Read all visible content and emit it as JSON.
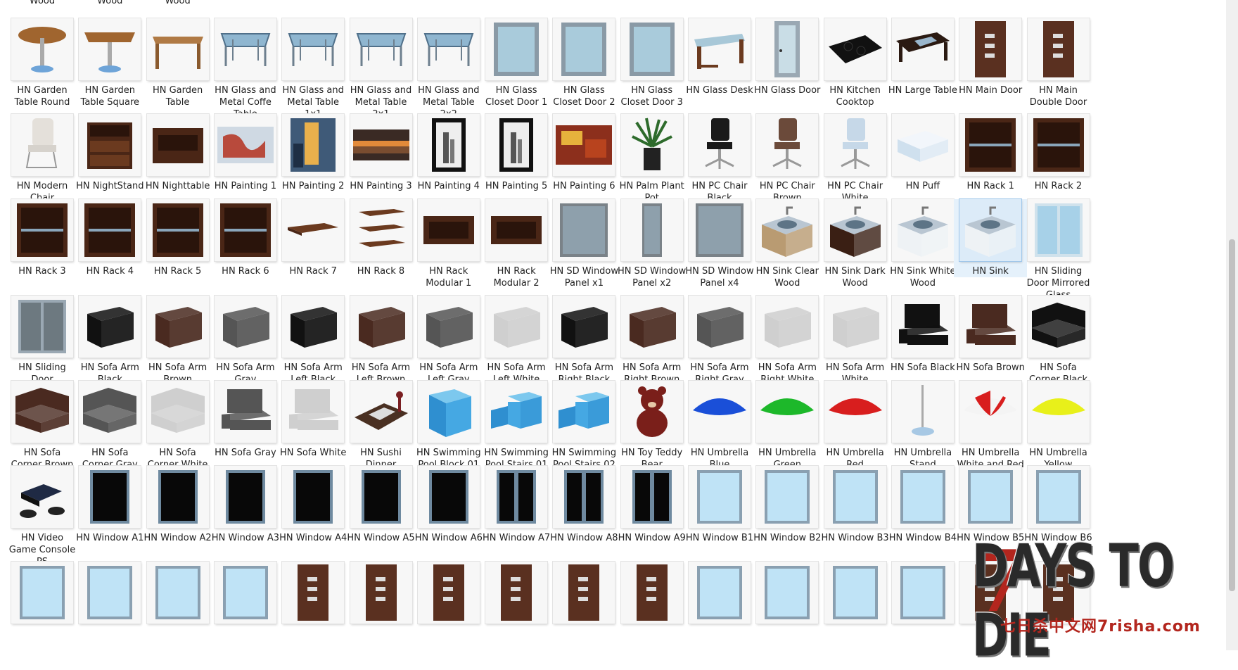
{
  "top_partial_labels": [
    "Wood",
    "Wood",
    "Wood"
  ],
  "items": [
    {
      "label": "HN Garden Table Round",
      "icon": "round-table"
    },
    {
      "label": "HN Garden Table Square",
      "icon": "square-table"
    },
    {
      "label": "HN Garden Table",
      "icon": "wood-table"
    },
    {
      "label": "HN Glass and Metal Coffe Table",
      "icon": "glass-table"
    },
    {
      "label": "HN Glass and Metal Table 1x1",
      "icon": "glass-table"
    },
    {
      "label": "HN Glass and Metal Table 2x1",
      "icon": "glass-table"
    },
    {
      "label": "HN Glass and Metal Table 2x2",
      "icon": "glass-table"
    },
    {
      "label": "HN Glass Closet Door 1",
      "icon": "glass-panel"
    },
    {
      "label": "HN Glass Closet Door 2",
      "icon": "glass-panel"
    },
    {
      "label": "HN Glass Closet Door 3",
      "icon": "glass-panel"
    },
    {
      "label": "HN Glass Desk",
      "icon": "desk"
    },
    {
      "label": "HN Glass Door",
      "icon": "door-glass"
    },
    {
      "label": "HN Kitchen Cooktop",
      "icon": "cooktop"
    },
    {
      "label": "HN Large Table",
      "icon": "dark-table"
    },
    {
      "label": "HN Main Door",
      "icon": "door"
    },
    {
      "label": "HN Main Double Door",
      "icon": "door"
    },
    {
      "label": "HN Modern Chair",
      "icon": "chair-white"
    },
    {
      "label": "HN NightStand",
      "icon": "nightstand"
    },
    {
      "label": "HN Nighttable",
      "icon": "nighttable"
    },
    {
      "label": "HN Painting 1",
      "icon": "painting-red"
    },
    {
      "label": "HN Painting 2",
      "icon": "painting-blue"
    },
    {
      "label": "HN Painting 3",
      "icon": "painting-sunset"
    },
    {
      "label": "HN Painting 4",
      "icon": "frame"
    },
    {
      "label": "HN Painting 5",
      "icon": "frame"
    },
    {
      "label": "HN Painting 6",
      "icon": "painting-warm"
    },
    {
      "label": "HN Palm Plant Pot",
      "icon": "plant"
    },
    {
      "label": "HN PC Chair Black",
      "icon": "pc-chair-black"
    },
    {
      "label": "HN PC Chair Brown",
      "icon": "pc-chair-brown"
    },
    {
      "label": "HN PC Chair White",
      "icon": "pc-chair-white"
    },
    {
      "label": "HN Puff",
      "icon": "puff"
    },
    {
      "label": "HN Rack 1",
      "icon": "rack"
    },
    {
      "label": "HN Rack 2",
      "icon": "rack"
    },
    {
      "label": "HN Rack 3",
      "icon": "rack"
    },
    {
      "label": "HN Rack 4",
      "icon": "rack"
    },
    {
      "label": "HN Rack 5",
      "icon": "rack"
    },
    {
      "label": "HN Rack 6",
      "icon": "rack"
    },
    {
      "label": "HN Rack 7",
      "icon": "shelf"
    },
    {
      "label": "HN Rack 8",
      "icon": "shelves"
    },
    {
      "label": "HN Rack Modular 1",
      "icon": "rack-modular"
    },
    {
      "label": "HN Rack Modular 2",
      "icon": "rack-modular"
    },
    {
      "label": "HN SD Window Panel x1",
      "icon": "window-panel"
    },
    {
      "label": "HN SD Window Panel x2",
      "icon": "window-panel-narrow"
    },
    {
      "label": "HN SD Window Panel x4",
      "icon": "window-panel"
    },
    {
      "label": "HN Sink Clear Wood",
      "icon": "sink-wood"
    },
    {
      "label": "HN Sink Dark Wood",
      "icon": "sink-dark"
    },
    {
      "label": "HN Sink White Wood",
      "icon": "sink-white"
    },
    {
      "label": "HN Sink",
      "icon": "sink-white",
      "selected": true
    },
    {
      "label": "HN Sliding Door Mirrored Glass",
      "icon": "sliding-glass"
    },
    {
      "label": "HN Sliding Door",
      "icon": "sliding-door"
    },
    {
      "label": "HN Sofa Arm Black",
      "icon": "sofa-arm-black"
    },
    {
      "label": "HN Sofa Arm Brown",
      "icon": "sofa-arm-brown"
    },
    {
      "label": "HN Sofa Arm Gray",
      "icon": "sofa-arm-gray"
    },
    {
      "label": "HN Sofa Arm Left Black",
      "icon": "sofa-arm-black"
    },
    {
      "label": "HN Sofa Arm Left Brown",
      "icon": "sofa-arm-brown"
    },
    {
      "label": "HN Sofa Arm Left Gray",
      "icon": "sofa-arm-gray"
    },
    {
      "label": "HN Sofa Arm Left White",
      "icon": "sofa-arm-white"
    },
    {
      "label": "HN Sofa Arm Right Black",
      "icon": "sofa-arm-black"
    },
    {
      "label": "HN Sofa Arm Right Brown",
      "icon": "sofa-arm-brown"
    },
    {
      "label": "HN Sofa Arm Right Gray",
      "icon": "sofa-arm-gray"
    },
    {
      "label": "HN Sofa Arm Right White",
      "icon": "sofa-arm-white"
    },
    {
      "label": "HN Sofa Arm White",
      "icon": "sofa-arm-white"
    },
    {
      "label": "HN Sofa Black",
      "icon": "sofa-black"
    },
    {
      "label": "HN Sofa Brown",
      "icon": "sofa-brown"
    },
    {
      "label": "HN Sofa Corner Black",
      "icon": "sofa-corner-black"
    },
    {
      "label": "HN Sofa Corner Brown",
      "icon": "sofa-corner-brown"
    },
    {
      "label": "HN Sofa Corner Gray",
      "icon": "sofa-corner-gray"
    },
    {
      "label": "HN Sofa Corner White",
      "icon": "sofa-corner-white"
    },
    {
      "label": "HN Sofa Gray",
      "icon": "sofa-gray"
    },
    {
      "label": "HN Sofa White",
      "icon": "sofa-white"
    },
    {
      "label": "HN Sushi Dinner",
      "icon": "sushi"
    },
    {
      "label": "HN Swimming Pool Block 01",
      "icon": "pool-block"
    },
    {
      "label": "HN Swimming Pool Stairs 01",
      "icon": "pool-stairs"
    },
    {
      "label": "HN Swimming Pool Stairs 02",
      "icon": "pool-stairs"
    },
    {
      "label": "HN Toy Teddy Bear",
      "icon": "teddy"
    },
    {
      "label": "HN Umbrella Blue",
      "icon": "umbrella-blue"
    },
    {
      "label": "HN Umbrella Green",
      "icon": "umbrella-green"
    },
    {
      "label": "HN Umbrella Red",
      "icon": "umbrella-red"
    },
    {
      "label": "HN Umbrella Stand",
      "icon": "umbrella-stand"
    },
    {
      "label": "HN Umbrella White and Red",
      "icon": "umbrella-whitered"
    },
    {
      "label": "HN Umbrella Yellow",
      "icon": "umbrella-yellow"
    },
    {
      "label": "HN Video Game Console PS",
      "icon": "console"
    },
    {
      "label": "HN Window A1",
      "icon": "window-dark"
    },
    {
      "label": "HN Window A2",
      "icon": "window-dark"
    },
    {
      "label": "HN Window A3",
      "icon": "window-dark"
    },
    {
      "label": "HN Window A4",
      "icon": "window-dark"
    },
    {
      "label": "HN Window A5",
      "icon": "window-dark"
    },
    {
      "label": "HN Window A6",
      "icon": "window-dark"
    },
    {
      "label": "HN Window A7",
      "icon": "window-dark-split"
    },
    {
      "label": "HN Window A8",
      "icon": "window-dark-split"
    },
    {
      "label": "HN Window A9",
      "icon": "window-dark-split"
    },
    {
      "label": "HN Window B1",
      "icon": "window-light"
    },
    {
      "label": "HN Window B2",
      "icon": "window-light"
    },
    {
      "label": "HN Window B3",
      "icon": "window-light"
    },
    {
      "label": "HN Window B4",
      "icon": "window-light"
    },
    {
      "label": "HN Window B5",
      "icon": "window-light"
    },
    {
      "label": "HN Window B6",
      "icon": "window-light"
    }
  ],
  "partial_row_icons": [
    "window-light",
    "window-light",
    "window-light",
    "window-light",
    "door",
    "door",
    "door",
    "door",
    "door",
    "door",
    "window-light",
    "window-light",
    "window-light",
    "window-light",
    "door",
    "door"
  ],
  "watermark": {
    "main": "DAYS TO DIE",
    "seven": "7",
    "sub": "七日杀中文网7risha.com"
  }
}
